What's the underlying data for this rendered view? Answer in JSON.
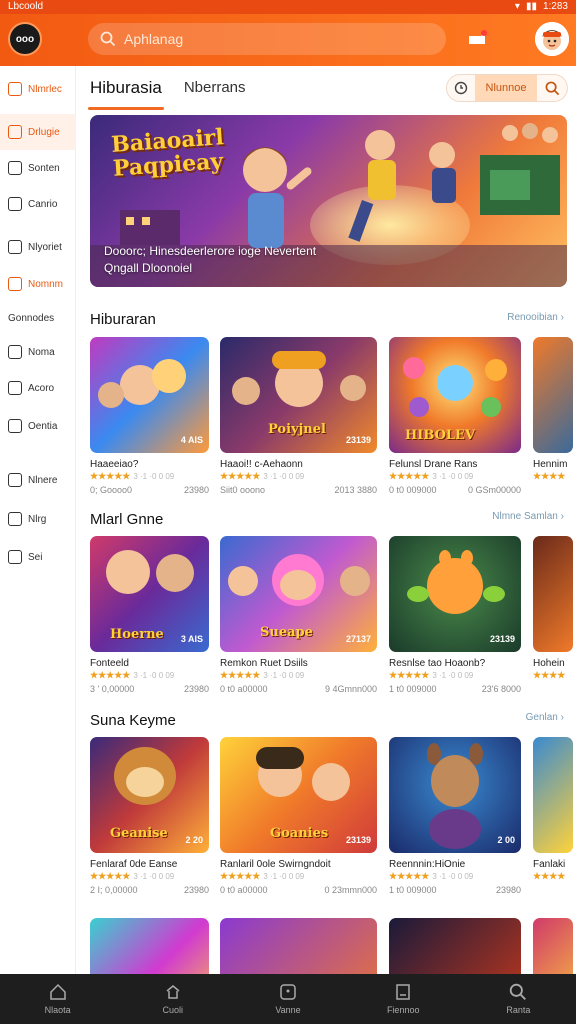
{
  "status": {
    "carrier": "Lbcoold",
    "time": "1:283"
  },
  "header": {
    "logo_text": "ooo",
    "search_placeholder": "Aphlanag"
  },
  "sidebar": {
    "items": [
      {
        "label": "Nlmrlec"
      },
      {
        "label": "Drlugie"
      },
      {
        "label": "Sonten"
      },
      {
        "label": "Canrio"
      },
      {
        "label": "Nlyoriet"
      },
      {
        "label": "Nomnm"
      },
      {
        "label": "Gonnodes"
      },
      {
        "label": "Noma"
      },
      {
        "label": "Acoro"
      },
      {
        "label": "Oentia"
      },
      {
        "label": "Nlnere"
      },
      {
        "label": "Nlrg"
      },
      {
        "label": "Sei"
      }
    ]
  },
  "tabs": {
    "active": "Hiburasia",
    "inactive": "Nberrans"
  },
  "tools": {
    "label": "Nlunnoe"
  },
  "hero": {
    "title_line1": "Baiaoairl",
    "title_line2": "Paqpieay",
    "caption_line1": "Dooorc; Hinesdeerlerore ioge Nevertent",
    "caption_line2": "Qngall Dloonoiel"
  },
  "sections": [
    {
      "title": "Hiburaran",
      "more": "Renooibian",
      "cards": [
        {
          "name": "Haaeeiao?",
          "rating": "★★★★★",
          "rating_count": "3 ·1 ·0 0 09",
          "downloads": "0; Goooo0",
          "size": "23980",
          "tag": "4 AIS"
        },
        {
          "name": "Haaoi!! c-Aehaonn",
          "rating": "★★★★★",
          "rating_count": "3 ·1 ·0 0 09",
          "downloads": "Siit0 ooono",
          "size": "2013 3880",
          "tag": "23139",
          "thumb_title": "Poiyjnel"
        },
        {
          "name": "Felunsl Drane Rans",
          "rating": "★★★★★",
          "rating_count": "3 ·1 ·0 0 09",
          "downloads": "0 t0 009000",
          "size": "0 GSm00000",
          "thumb_title": "HIBOLEV"
        },
        {
          "name": "Hennim",
          "rating": "★★★★",
          "rating_count": "",
          "downloads": "",
          "size": ""
        }
      ]
    },
    {
      "title": "Mlarl Gnne",
      "more": "Nlmne Samlan",
      "cards": [
        {
          "name": "Fonteeld",
          "rating": "★★★★★",
          "rating_count": "3 ·1 ·0 0 09",
          "downloads": "3 ' 0,00000",
          "size": "23980",
          "thumb_title": "Hoerne",
          "tag": "3 AIS"
        },
        {
          "name": "Remkon Ruet Dsiils",
          "rating": "★★★★★",
          "rating_count": "3 ·1 ·0 0 09",
          "downloads": "0 t0 a00000",
          "size": "9 4Gmnn000",
          "thumb_title": "Sueape",
          "tag": "27137"
        },
        {
          "name": "Resnlse tao Hoaonb?",
          "rating": "★★★★★",
          "rating_count": "3 ·1 ·0 0 09",
          "downloads": "1 t0 009000",
          "size": "23'6 8000",
          "tag": "23139"
        },
        {
          "name": "Hohein",
          "rating": "★★★★",
          "rating_count": "",
          "downloads": "",
          "size": ""
        }
      ]
    },
    {
      "title": "Suna Keyme",
      "more": "Genlan",
      "cards": [
        {
          "name": "Fenlaraf 0de Eanse",
          "rating": "★★★★★",
          "rating_count": "3 ·1 ·0 0 09",
          "downloads": "2 I; 0,00000",
          "size": "23980",
          "thumb_title": "Geanise",
          "tag": "2 20"
        },
        {
          "name": "Ranlaril 0ole Swirngndoit",
          "rating": "★★★★★",
          "rating_count": "3 ·1 ·0 0 09",
          "downloads": "0 t0 a00000",
          "size": "0 23mmn000",
          "thumb_title": "Goanies",
          "tag": "23139"
        },
        {
          "name": "Reennnin:HiOnie",
          "rating": "★★★★★",
          "rating_count": "3 ·1 ·0 0 09",
          "downloads": "1 t0 009000",
          "size": "23980",
          "tag": "2 00"
        },
        {
          "name": "Fanlaki",
          "rating": "★★★★",
          "rating_count": "",
          "downloads": "",
          "size": ""
        }
      ]
    }
  ],
  "bottom_nav": [
    {
      "label": "Nlaota"
    },
    {
      "label": "Cuoli"
    },
    {
      "label": "Vanne"
    },
    {
      "label": "Fiennoo"
    },
    {
      "label": "Ranta"
    }
  ],
  "colors": {
    "accent": "#f25a12",
    "nav_bg": "#1e1e1e",
    "star": "#f0a020"
  }
}
